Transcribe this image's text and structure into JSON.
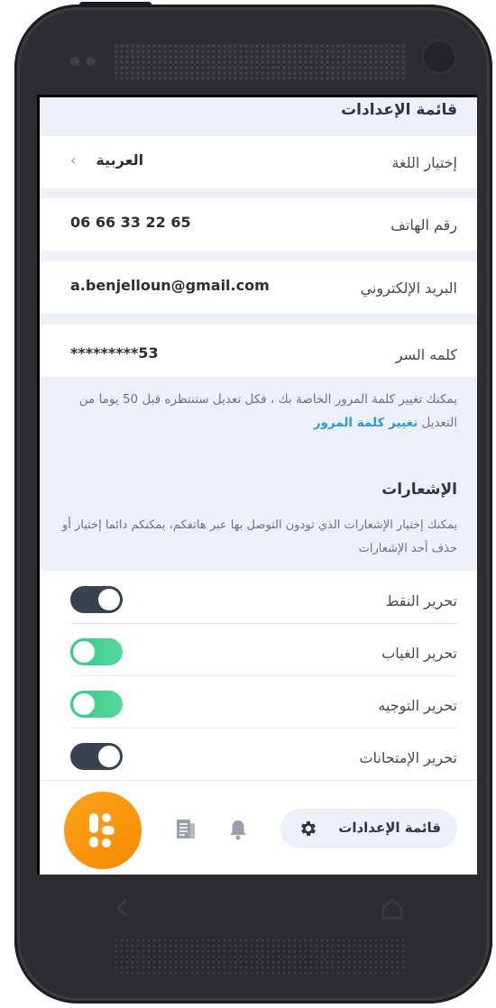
{
  "header": {
    "title": "قائمة الإعدادات"
  },
  "settings": {
    "language": {
      "label": "إختيار اللغة",
      "value": "العربية",
      "chevron": "‹"
    },
    "phone": {
      "label": "رقم الهاتف",
      "value": "06 66 33 22 65"
    },
    "email": {
      "label": "البريد الإلكتروني",
      "value": "a.benjelloun@gmail.com"
    },
    "password": {
      "label": "كلمه السر",
      "value": "*********53"
    }
  },
  "password_note": {
    "text": "يمكنك تغيير كلمة المرور الخاصة بك ، فكل تعديل ستنتظره قبل 50 يوما من التعديل",
    "link": "تغيير كلمة المرور"
  },
  "notifications": {
    "title": "الإشعارات",
    "description": "يمكنك إختيار الإشعارات الذي تودون التوصل بها عبر هاتفكم، يمكنكم دائما إختيار أو حذف أحد الإشعارات",
    "items": [
      {
        "label": "تحرير النقط",
        "state": "dark"
      },
      {
        "label": "تحرير الغياب",
        "state": "green"
      },
      {
        "label": "تحرير التوجيه",
        "state": "green"
      },
      {
        "label": "تحرير الإمتحانات",
        "state": "dark"
      }
    ]
  },
  "bottom_nav": {
    "active_label": "قائمة الإعدادات",
    "icons": [
      "gear-icon",
      "bell-icon",
      "document-icon",
      "app-logo"
    ]
  },
  "colors": {
    "accent_orange": "#f7941d",
    "toggle_green": "#2ecc8a",
    "toggle_dark": "#3a4252",
    "link_blue": "#2d9cdb",
    "background": "#edf1f7"
  }
}
